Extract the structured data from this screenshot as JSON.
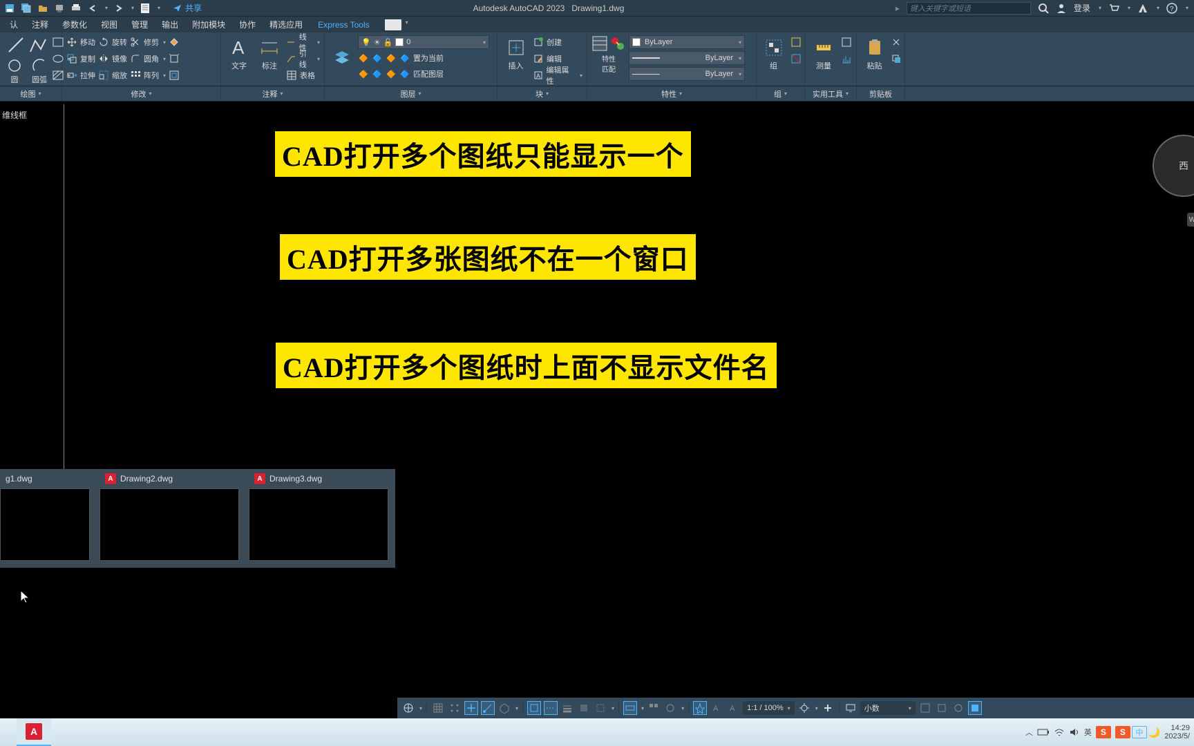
{
  "title": {
    "app": "Autodesk AutoCAD 2023",
    "file": "Drawing1.dwg"
  },
  "search": {
    "placeholder": "键入关键字或短语"
  },
  "login": "登录",
  "share": "共享",
  "menu": [
    "认",
    "注释",
    "参数化",
    "视图",
    "管理",
    "输出",
    "附加模块",
    "协作",
    "精选应用",
    "Express Tools"
  ],
  "ribbon": {
    "draw": {
      "big": [
        "直?",
        "圆",
        "圆弧"
      ],
      "title": "绘图"
    },
    "modify": {
      "rows": [
        [
          "移动",
          "修剪"
        ],
        [
          "复制",
          "镜像",
          "圆角"
        ],
        [
          "拉伸",
          "缩放",
          "阵列"
        ]
      ],
      "rotate": "旋转",
      "title": "修改"
    },
    "annotate": {
      "text": "文字",
      "dim": "标注",
      "rows": [
        "线性",
        "引线",
        "表格"
      ],
      "title": "注释"
    },
    "layers": {
      "big": "图层\n特性",
      "combo_val": "0",
      "rows": [
        "置为当前",
        "匹配图层"
      ],
      "title": "图层"
    },
    "block": {
      "big": "插入",
      "rows": [
        "创建",
        "编辑",
        "编辑属性"
      ],
      "title": "块"
    },
    "props": {
      "big": "特性\n匹配",
      "vals": [
        "ByLayer",
        "ByLayer",
        "ByLayer"
      ],
      "title": "特性"
    },
    "group": {
      "big": "组",
      "title": "组"
    },
    "util": {
      "big": "测量",
      "title": "实用工具"
    },
    "clip": {
      "big": "粘贴",
      "title": "剪贴板"
    }
  },
  "viewport_label": "维线框",
  "texts": [
    "CAD打开多个图纸只能显示一个",
    "CAD打开多张图纸不在一个窗口",
    "CAD打开多个图纸时上面不显示文件名"
  ],
  "nav": "西",
  "previews": [
    "g1.dwg",
    "Drawing2.dwg",
    "Drawing3.dwg"
  ],
  "status": {
    "scale": "1:1 / 100%",
    "mode": "小数"
  },
  "tray": {
    "ime": "中",
    "time": "14:29",
    "date": "2023/5/",
    "en": "英"
  }
}
